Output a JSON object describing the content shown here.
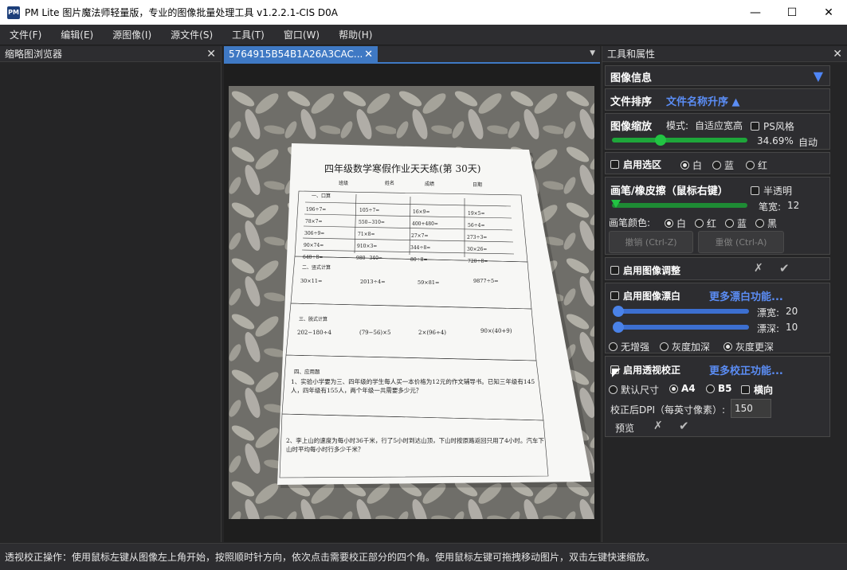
{
  "window": {
    "logo_text": "PM",
    "title": "PM Lite 图片魔法师轻量版，专业的图像批量处理工具 v1.2.2.1-CIS D0A",
    "minimize": "—",
    "maximize": "☐",
    "close": "✕"
  },
  "menu": [
    "文件(F)",
    "编辑(E)",
    "源图像(I)",
    "源文件(S)",
    "工具(T)",
    "窗口(W)",
    "帮助(H)"
  ],
  "left_panel": {
    "title": "缩略图浏览器",
    "close": "✕"
  },
  "document": {
    "tab_label": "5764915B54B1A26A3CAC...",
    "tab_close": "✕",
    "dropdown": "▼"
  },
  "worksheet": {
    "title": "四年级数学寒假作业天天练(第 30天)",
    "header_fields": [
      "班级",
      "姓名",
      "成绩",
      "日期"
    ],
    "section1": "一、口算",
    "oral_rows": [
      [
        "196÷7=",
        "105÷7=",
        "16×9=",
        "19×5="
      ],
      [
        "78×7=",
        "550−310=",
        "400+480=",
        "56÷4="
      ],
      [
        "306÷9=",
        "71×8=",
        "27×7=",
        "273÷3="
      ],
      [
        "90×74=",
        "910×3=",
        "344÷8=",
        "30×26="
      ],
      [
        "640÷8=",
        "980−340=",
        "80÷8=",
        "720÷8="
      ]
    ],
    "section2": "二、竖式计算",
    "vertical": [
      "30×11=",
      "2013÷4=",
      "59×81=",
      "9877÷5="
    ],
    "section3": "三、脱式计算",
    "stepwise": [
      "202−180÷4",
      "(79−56)×5",
      "2×(96÷4)",
      "90×(40+9)"
    ],
    "section4": "四、应用题",
    "q1": "1、实验小学要为三、四年级的学生每人买一本价格为12元的作文辅导书。已知三年级有145人，四年级有155人，两个年级一共需要多少元？",
    "q2": "2、李上山的速度为每小时36千米，行了5小时到达山顶，下山时按原路返回只用了4小时。汽车下山时平均每小时行多少千米？"
  },
  "right_panel": {
    "title": "工具和属性",
    "close": "✕",
    "image_info": {
      "label": "图像信息",
      "arrow": "▼"
    },
    "sort": {
      "label": "文件排序",
      "value": "文件名称升序 ▲"
    },
    "zoom": {
      "label": "图像缩放",
      "mode_label": "模式:",
      "mode_value": "自适应宽高",
      "ps_style": "PS风格",
      "percent": "34.69%",
      "auto": "自动",
      "level": 0.36
    },
    "select": {
      "label": "启用选区",
      "options": [
        "白",
        "蓝",
        "红"
      ]
    },
    "pen": {
      "label": "画笔/橡皮擦（鼠标右键）",
      "semi": "半透明",
      "width_label": "笔宽:",
      "width_value": "12",
      "color_label": "画笔颜色:",
      "colors": [
        "白",
        "红",
        "蓝",
        "黑"
      ],
      "undo": "撤销 (Ctrl-Z)",
      "redo": "重做 (Ctrl-A)"
    },
    "adjust": {
      "label": "启用图像调整",
      "cancel": "✗",
      "ok": "✔"
    },
    "whiten": {
      "label": "启用图像漂白",
      "more": "更多漂白功能...",
      "width_label": "漂宽:",
      "width_value": "20",
      "depth_label": "漂深:",
      "depth_value": "10",
      "modes": [
        "无增强",
        "灰度加深",
        "灰度更深"
      ]
    },
    "perspective": {
      "label": "启用透视校正",
      "more": "更多校正功能...",
      "sizes": [
        "默认尺寸",
        "A4",
        "B5"
      ],
      "landscape": "横向",
      "dpi_label": "校正后DPI（每英寸像素）:",
      "dpi_value": "150",
      "preview": "预览",
      "cancel": "✗",
      "ok": "✔"
    }
  },
  "status": "透视校正操作：使用鼠标左键从图像左上角开始，按照顺时针方向，依次点击需要校正部分的四个角。使用鼠标左键可拖拽移动图片，双击左键快速缩放。"
}
